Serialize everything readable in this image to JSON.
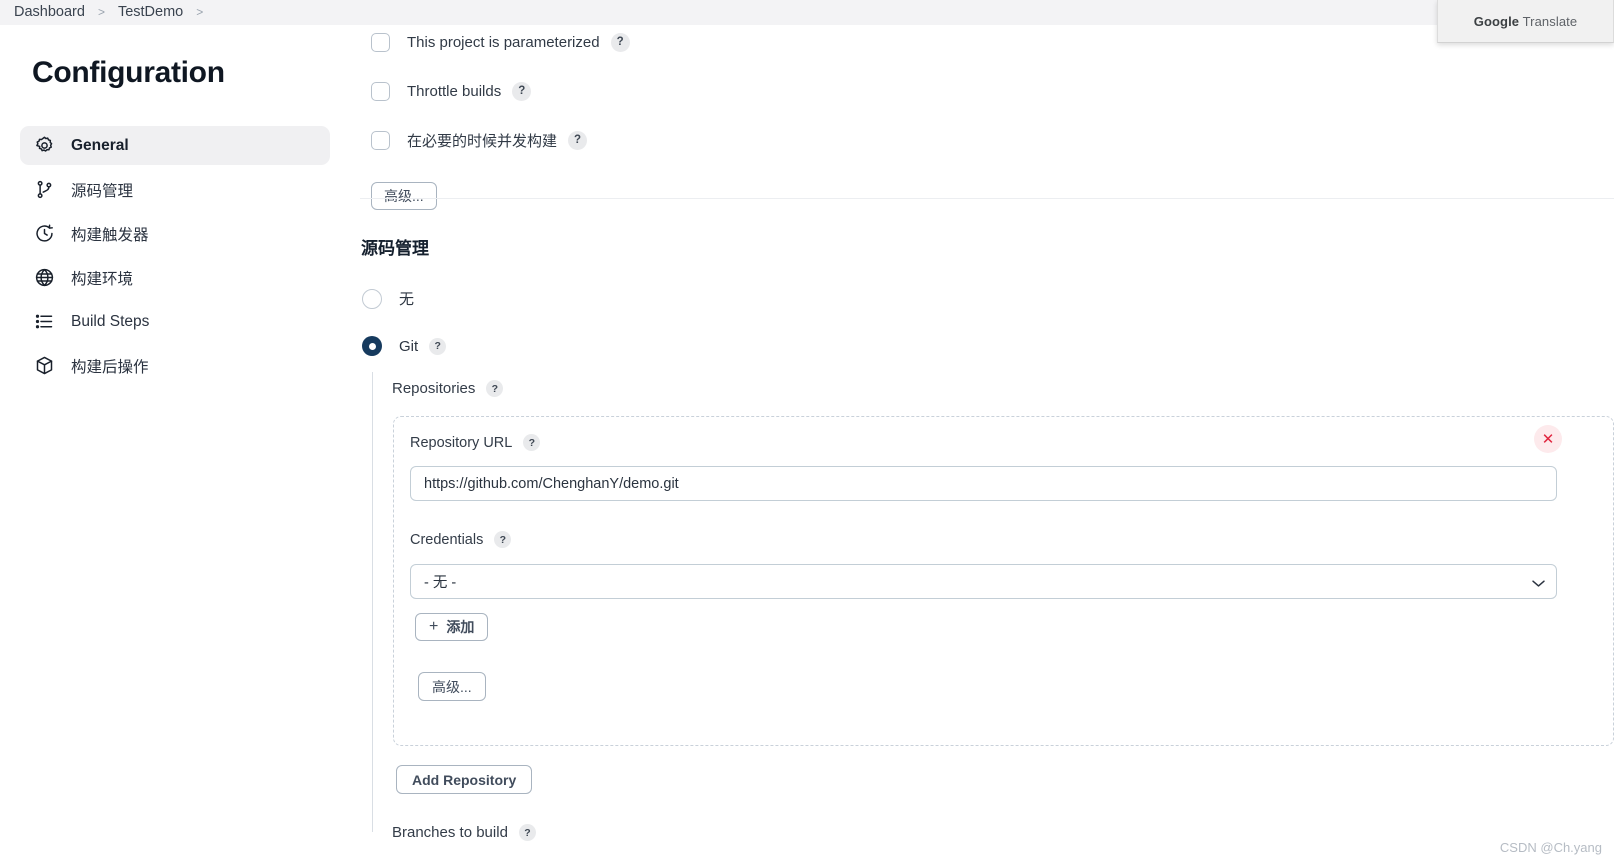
{
  "breadcrumb": {
    "items": [
      "Dashboard",
      "TestDemo"
    ],
    "separator": ">",
    "item0": "Dashboard",
    "item1": "TestDemo"
  },
  "translate_popup": {
    "brand": "Google",
    "word": " Translate"
  },
  "page_title": "Configuration",
  "sidebar": {
    "items": [
      {
        "label": "General",
        "icon": "gear-icon",
        "active": true
      },
      {
        "label": "源码管理",
        "icon": "git-branch-icon",
        "active": false
      },
      {
        "label": "构建触发器",
        "icon": "clock-icon",
        "active": false
      },
      {
        "label": "构建环境",
        "icon": "globe-icon",
        "active": false
      },
      {
        "label": "Build Steps",
        "icon": "list-icon",
        "active": false
      },
      {
        "label": "构建后操作",
        "icon": "package-icon",
        "active": false
      }
    ],
    "item0": "General",
    "item1": "源码管理",
    "item2": "构建触发器",
    "item3": "构建环境",
    "item4": "Build Steps",
    "item5": "构建后操作"
  },
  "general": {
    "checkboxes": [
      {
        "label": "This project is parameterized",
        "checked": false,
        "help": "?"
      },
      {
        "label": "Throttle builds",
        "checked": false,
        "help": "?"
      },
      {
        "label": "在必要的时候并发构建",
        "checked": false,
        "help": "?"
      }
    ],
    "chk0": "This project is parameterized",
    "chk1": "Throttle builds",
    "chk2": "在必要的时候并发构建",
    "advanced_button": "高级..."
  },
  "scm": {
    "section_title": "源码管理",
    "options": [
      {
        "label": "无",
        "selected": false
      },
      {
        "label": "Git",
        "selected": true,
        "help": "?"
      }
    ],
    "option_none": "无",
    "option_git": "Git",
    "repositories_label": "Repositories",
    "repository": {
      "url_label": "Repository URL",
      "url_value": "https://github.com/ChenghanY/demo.git",
      "credentials_label": "Credentials",
      "credentials_value": "- 无 -",
      "add_credentials_button": "添加",
      "add_credentials_icon": "plus-icon",
      "advanced_button": "高级...",
      "remove_icon": "close-icon"
    },
    "add_repository_button": "Add Repository",
    "branches_label": "Branches to build"
  },
  "help_glyph": "?",
  "watermark": "CSDN @Ch.yang",
  "colors": {
    "accent": "#163a5e",
    "header_bg": "#f3f3f5",
    "sidebar_active": "#f0f0f2",
    "border": "#c3ced6",
    "danger": "#e0253f"
  }
}
